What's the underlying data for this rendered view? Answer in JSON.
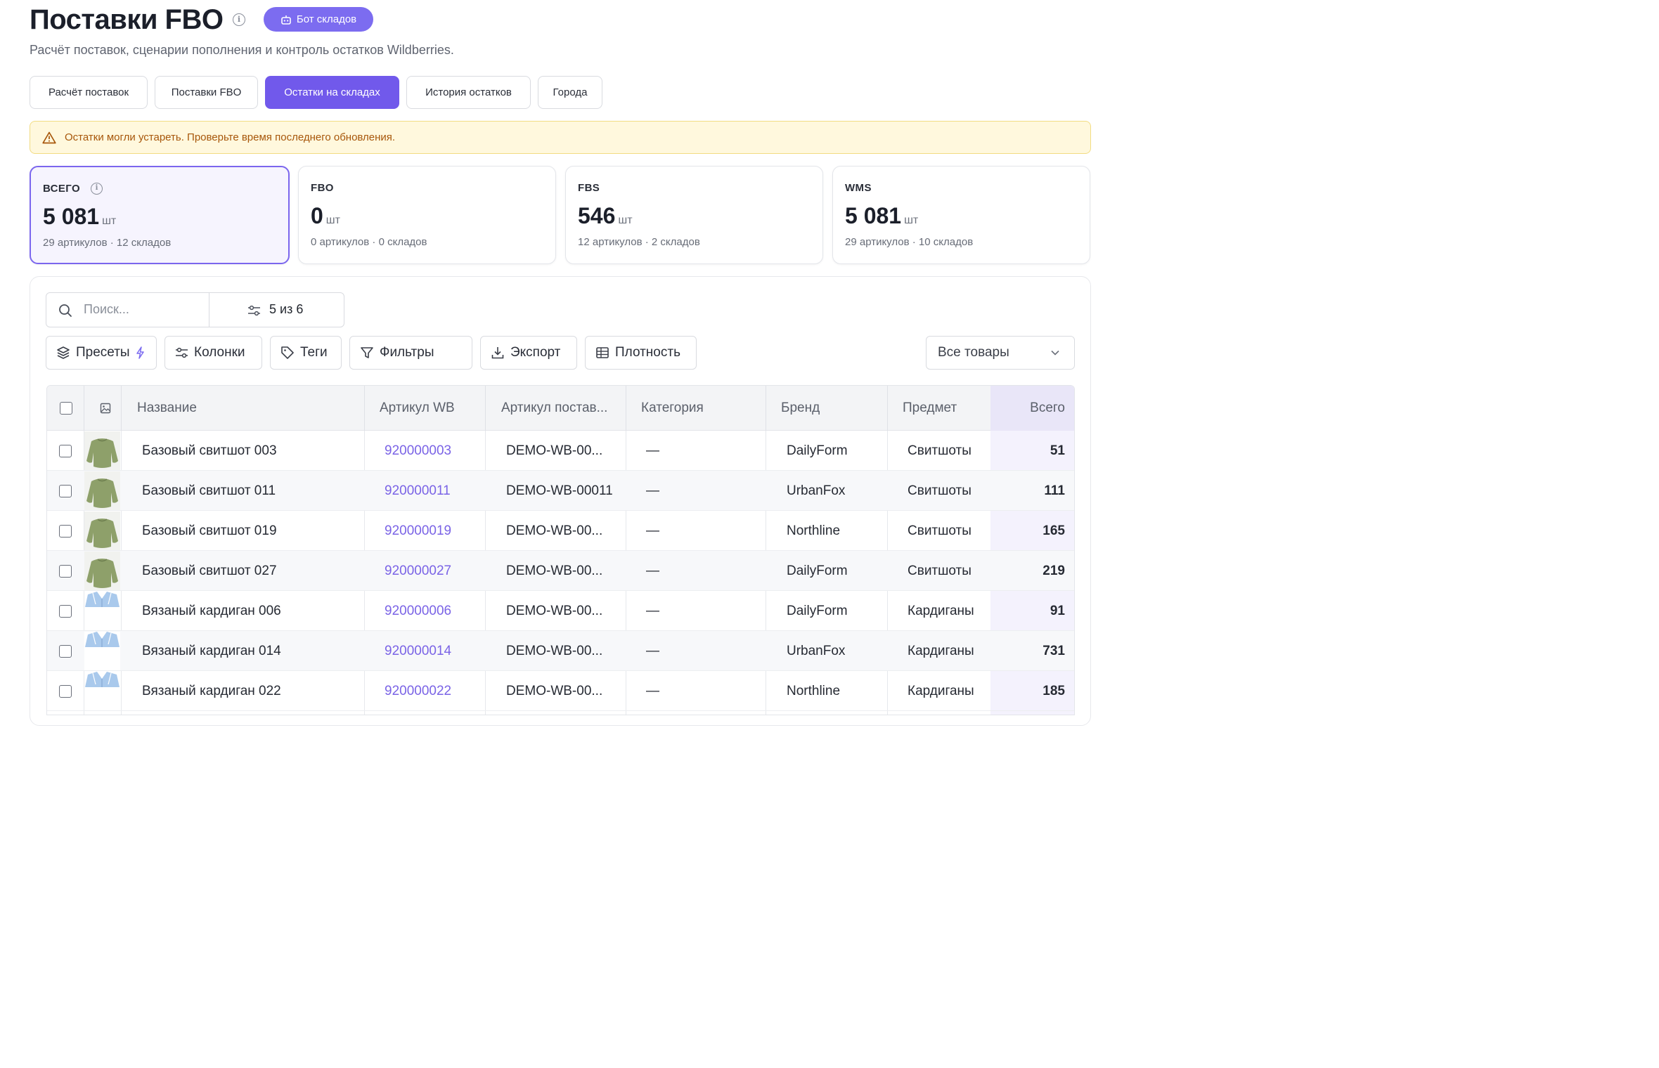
{
  "header": {
    "title": "Поставки FBO",
    "bot_button": "Бот складов",
    "subtitle": "Расчёт поставок, сценарии пополнения и контроль остатков Wildberries."
  },
  "tabs": [
    {
      "label": "Расчёт поставок",
      "active": false
    },
    {
      "label": "Поставки FBO",
      "active": false
    },
    {
      "label": "Остатки на складах",
      "active": true
    },
    {
      "label": "История остатков",
      "active": false
    },
    {
      "label": "Города",
      "active": false
    }
  ],
  "warning": "Остатки могли устареть. Проверьте время последнего обновления.",
  "cards": [
    {
      "label": "ВСЕГО",
      "value": "5 081",
      "unit": "шт",
      "sub": "29 артикулов · 12 складов",
      "selected": true
    },
    {
      "label": "FBO",
      "value": "0",
      "unit": "шт",
      "sub": "0 артикулов · 0 складов",
      "selected": false
    },
    {
      "label": "FBS",
      "value": "546",
      "unit": "шт",
      "sub": "12 артикулов · 2 складов",
      "selected": false
    },
    {
      "label": "WMS",
      "value": "5 081",
      "unit": "шт",
      "sub": "29 артикулов · 10 складов",
      "selected": false
    }
  ],
  "toolbar": {
    "search_placeholder": "Поиск...",
    "columns_count": "5 из 6",
    "presets": "Пресеты",
    "columns": "Колонки",
    "tags": "Теги",
    "filters": "Фильтры",
    "export": "Экспорт",
    "density": "Плотность",
    "product_filter": "Все товары"
  },
  "table": {
    "headers": {
      "name": "Название",
      "article_wb": "Артикул WB",
      "supplier_article": "Артикул постав...",
      "category": "Категория",
      "brand": "Бренд",
      "subject": "Предмет",
      "total": "Всего"
    },
    "rows": [
      {
        "name": "Базовый свитшот 003",
        "article_wb": "920000003",
        "supplier_article": "DEMO-WB-00...",
        "category": "—",
        "brand": "DailyForm",
        "subject": "Свитшоты",
        "total": "51",
        "thumb": "sweatshirt"
      },
      {
        "name": "Базовый свитшот 011",
        "article_wb": "920000011",
        "supplier_article": "DEMO-WB-00011",
        "category": "—",
        "brand": "UrbanFox",
        "subject": "Свитшоты",
        "total": "111",
        "thumb": "sweatshirt"
      },
      {
        "name": "Базовый свитшот 019",
        "article_wb": "920000019",
        "supplier_article": "DEMO-WB-00...",
        "category": "—",
        "brand": "Northline",
        "subject": "Свитшоты",
        "total": "165",
        "thumb": "sweatshirt"
      },
      {
        "name": "Базовый свитшот 027",
        "article_wb": "920000027",
        "supplier_article": "DEMO-WB-00...",
        "category": "—",
        "brand": "DailyForm",
        "subject": "Свитшоты",
        "total": "219",
        "thumb": "sweatshirt"
      },
      {
        "name": "Вязаный кардиган 006",
        "article_wb": "920000006",
        "supplier_article": "DEMO-WB-00...",
        "category": "—",
        "brand": "DailyForm",
        "subject": "Кардиганы",
        "total": "91",
        "thumb": "cardigan"
      },
      {
        "name": "Вязаный кардиган 014",
        "article_wb": "920000014",
        "supplier_article": "DEMO-WB-00...",
        "category": "—",
        "brand": "UrbanFox",
        "subject": "Кардиганы",
        "total": "731",
        "thumb": "cardigan"
      },
      {
        "name": "Вязаный кардиган 022",
        "article_wb": "920000022",
        "supplier_article": "DEMO-WB-00...",
        "category": "—",
        "brand": "Northline",
        "subject": "Кардиганы",
        "total": "185",
        "thumb": "cardigan"
      }
    ]
  },
  "colors": {
    "accent": "#7159eb",
    "link": "#7a63e6",
    "warning_bg": "#fff8dd",
    "warning_text": "#a7560a",
    "sweatshirt": "#8ea06a",
    "cardigan": "#a9c9ec"
  }
}
